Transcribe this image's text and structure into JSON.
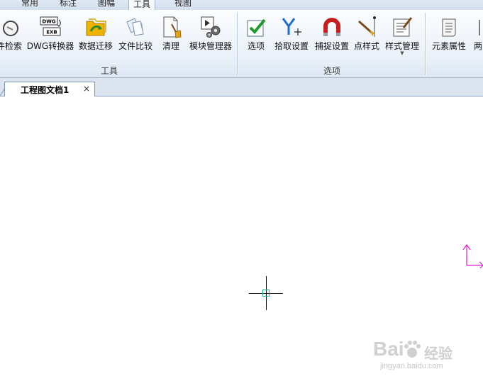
{
  "ribbon": {
    "tabs": [
      {
        "label": "常用"
      },
      {
        "label": "标注"
      },
      {
        "label": "图幅"
      },
      {
        "label": "工具"
      },
      {
        "label": "视图"
      }
    ],
    "groups": {
      "tools": {
        "label": "工具",
        "buttons": [
          {
            "label": "件检索"
          },
          {
            "label": "DWG转换器",
            "icon_text_top": "DWG",
            "icon_text_bottom": "EXB"
          },
          {
            "label": "数据迁移"
          },
          {
            "label": "文件比较"
          },
          {
            "label": "清理"
          },
          {
            "label": "模块管理器"
          }
        ]
      },
      "options": {
        "label": "选项",
        "buttons": [
          {
            "label": "选项"
          },
          {
            "label": "拾取设置"
          },
          {
            "label": "捕捉设置"
          },
          {
            "label": "点样式"
          },
          {
            "label": "样式管理"
          }
        ]
      },
      "properties": {
        "buttons": [
          {
            "label": "元素属性"
          },
          {
            "label": "两"
          }
        ]
      }
    }
  },
  "document": {
    "tab_title": "工程图文档1",
    "close_glyph": "×"
  },
  "watermark": {
    "brand": "Bai",
    "brand2": "经验",
    "url": "jingyan.baidu.com"
  },
  "colors": {
    "accent_blue": "#1e6fd0",
    "pick_box": "#18b89a",
    "ucs_axis": "#e020c8"
  }
}
